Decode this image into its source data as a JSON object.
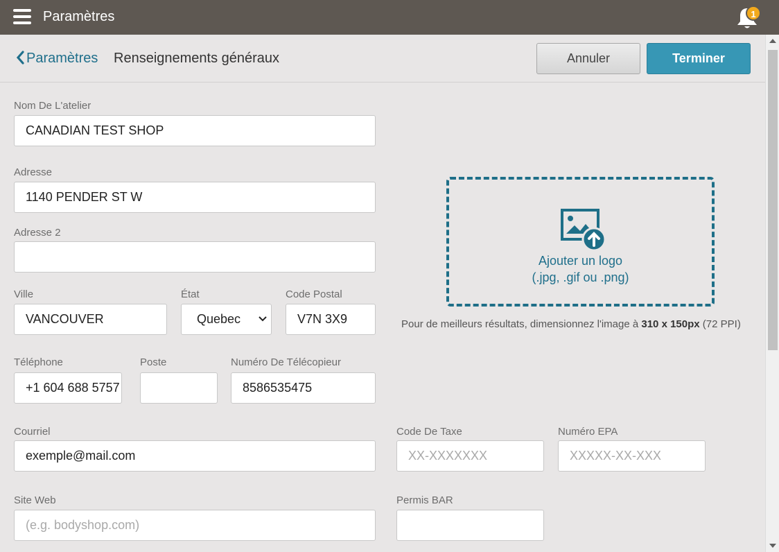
{
  "header": {
    "title": "Paramètres",
    "notification_count": "1"
  },
  "subheader": {
    "back_label": "Paramètres",
    "page_title": "Renseignements généraux",
    "cancel_label": "Annuler",
    "done_label": "Terminer"
  },
  "form": {
    "shop_name": {
      "label": "Nom De L'atelier",
      "value": "CANADIAN TEST SHOP"
    },
    "address": {
      "label": "Adresse",
      "value": "1140 PENDER ST W"
    },
    "address2": {
      "label": "Adresse 2",
      "value": ""
    },
    "city": {
      "label": "Ville",
      "value": "VANCOUVER"
    },
    "state": {
      "label": "État",
      "value": "Quebec"
    },
    "postal": {
      "label": "Code Postal",
      "value": "V7N 3X9"
    },
    "phone": {
      "label": "Téléphone",
      "value": "+1 604 688 5757"
    },
    "ext": {
      "label": "Poste",
      "value": ""
    },
    "fax": {
      "label": "Numéro De Télécopieur",
      "value": "8586535475"
    },
    "email": {
      "label": "Courriel",
      "value": "exemple@mail.com"
    },
    "tax": {
      "label": "Code De Taxe",
      "placeholder": "XX-XXXXXXX"
    },
    "epa": {
      "label": "Numéro EPA",
      "placeholder": "XXXXX-XX-XXX"
    },
    "website": {
      "label": "Site Web",
      "placeholder": "(e.g. bodyshop.com)"
    },
    "bar": {
      "label": "Permis BAR",
      "value": ""
    }
  },
  "logo": {
    "line1": "Ajouter un logo",
    "line2": "(.jpg, .gif ou .png)",
    "hint_prefix": "Pour de meilleurs résultats, dimensionnez l'image à ",
    "hint_size": "310 x 150px",
    "hint_suffix": " (72 PPI)"
  },
  "colors": {
    "topbar": "#5e5852",
    "accent": "#3797b5",
    "link": "#1f6f8b",
    "badge": "#f2a91c"
  }
}
